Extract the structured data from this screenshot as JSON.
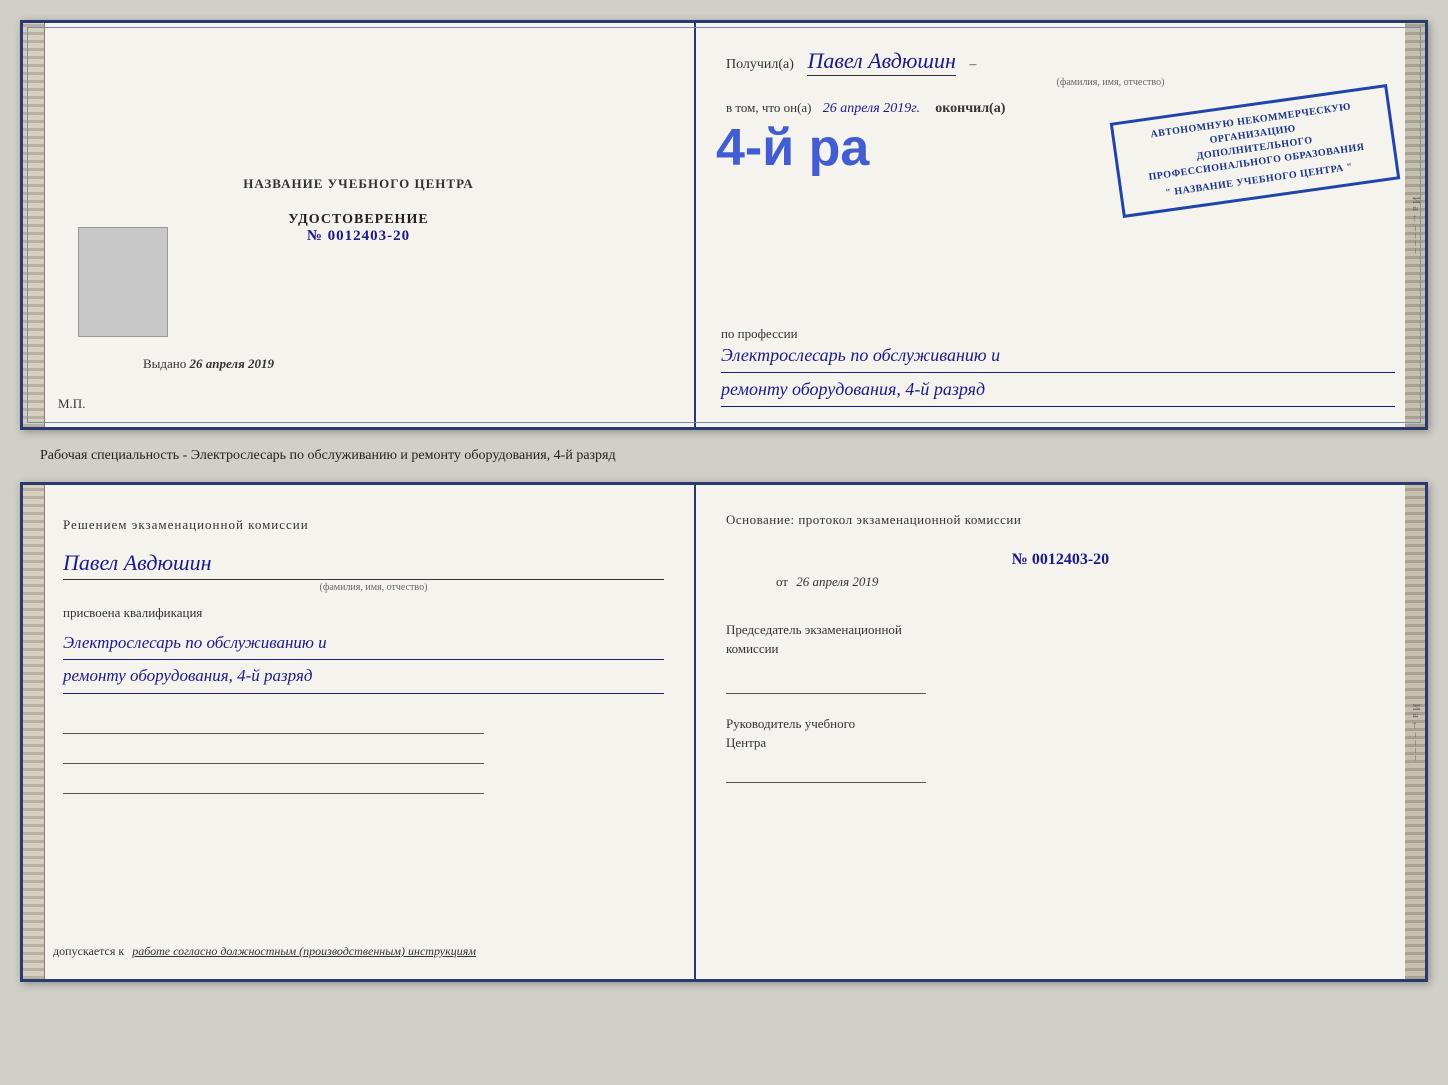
{
  "top_cert": {
    "left": {
      "title": "НАЗВАНИЕ УЧЕБНОГО ЦЕНТРА",
      "udostoverenie_label": "УДОСТОВЕРЕНИЕ",
      "number": "№ 0012403-20",
      "vydano_label": "Выдано",
      "vydano_date": "26 апреля 2019",
      "mp_label": "М.П."
    },
    "right": {
      "poluchil_prefix": "Получил(а)",
      "name_handwritten": "Павел Авдюшин",
      "fio_label": "(фамилия, имя, отчество)",
      "dash": "–",
      "v_tom_chto_prefix": "в том, что он(а)",
      "date_handwritten": "26 апреля 2019г.",
      "okonchil_label": "окончил(а)",
      "big_number": "4-й ра",
      "stamp_line1": "АВТОНОМНУЮ НЕКОММЕРЧЕСКУЮ ОРГАНИЗАЦИЮ",
      "stamp_line2": "ДОПОЛНИТЕЛЬНОГО ПРОФЕССИОНАЛЬНОГО ОБРАЗОВАНИЯ",
      "stamp_name": "\" НАЗВАНИЕ УЧЕБНОГО ЦЕНТРА \"",
      "po_professii_label": "по профессии",
      "profession_line1": "Электрослесарь по обслуживанию и",
      "profession_line2": "ремонту оборудования, 4-й разряд"
    }
  },
  "middle": {
    "text": "Рабочая специальность - Электрослесарь по обслуживанию и ремонту оборудования, 4-й разряд"
  },
  "bottom_cert": {
    "left": {
      "resheniem_line1": "Решением экзаменационной комиссии",
      "person_name": "Павел Авдюшин",
      "fio_label": "(фамилия, имя, отчество)",
      "prisvoena_label": "присвоена квалификация",
      "kval_line1": "Электрослесарь по обслуживанию и",
      "kval_line2": "ремонту оборудования, 4-й разряд",
      "dopusk_prefix": "допускается к",
      "dopusk_text": "работе согласно должностным (производственным) инструкциям"
    },
    "right": {
      "osnovanie_label": "Основание: протокол экзаменационной комиссии",
      "protocol_number": "№  0012403-20",
      "ot_prefix": "от",
      "ot_date": "26 апреля 2019",
      "predsedatel_line1": "Председатель экзаменационной",
      "predsedatel_line2": "комиссии",
      "rukovoditel_line1": "Руководитель учебного",
      "rukovoditel_line2": "Центра"
    }
  },
  "side_chars": {
    "top_right": "И а ← – – – – –",
    "bottom_right": "И а ← – – – – –"
  }
}
